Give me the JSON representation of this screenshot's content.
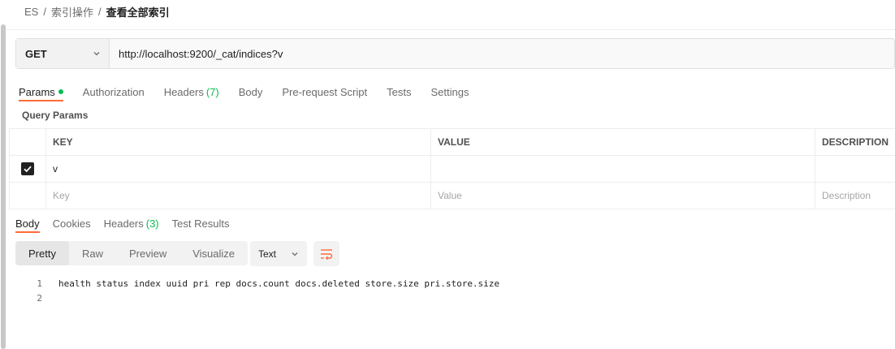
{
  "breadcrumb": {
    "items": [
      "ES",
      "索引操作"
    ],
    "separator": "/",
    "current": "查看全部索引"
  },
  "request": {
    "method": "GET",
    "url": "http://localhost:9200/_cat/indices?v"
  },
  "request_tabs": [
    {
      "label": "Params",
      "active": true
    },
    {
      "label": "Authorization"
    },
    {
      "label": "Headers",
      "count": "(7)"
    },
    {
      "label": "Body"
    },
    {
      "label": "Pre-request Script"
    },
    {
      "label": "Tests"
    },
    {
      "label": "Settings"
    }
  ],
  "query_params": {
    "title": "Query Params",
    "columns": {
      "key": "KEY",
      "value": "VALUE",
      "description": "DESCRIPTION"
    },
    "rows": [
      {
        "checked": true,
        "key": "v",
        "value": "",
        "description": ""
      }
    ],
    "placeholders": {
      "key": "Key",
      "value": "Value",
      "description": "Description"
    }
  },
  "response_tabs": [
    {
      "label": "Body",
      "active": true
    },
    {
      "label": "Cookies"
    },
    {
      "label": "Headers",
      "count": "(3)"
    },
    {
      "label": "Test Results"
    }
  ],
  "view_modes": [
    {
      "label": "Pretty",
      "active": true
    },
    {
      "label": "Raw"
    },
    {
      "label": "Preview"
    },
    {
      "label": "Visualize"
    }
  ],
  "format": {
    "selected": "Text"
  },
  "response_body": {
    "lines": [
      {
        "no": "1",
        "text": "health status index uuid pri rep docs.count docs.deleted store.size pri.store.size"
      },
      {
        "no": "2",
        "text": ""
      }
    ]
  },
  "colors": {
    "accent": "#ff6c37",
    "success": "#0cbb52"
  },
  "icons": {
    "method_dropdown": "chevron-down-icon",
    "format_dropdown": "chevron-down-icon",
    "wrap": "wrap-lines-icon",
    "checkbox": "check-icon",
    "params_indicator": "status-dot-icon"
  }
}
